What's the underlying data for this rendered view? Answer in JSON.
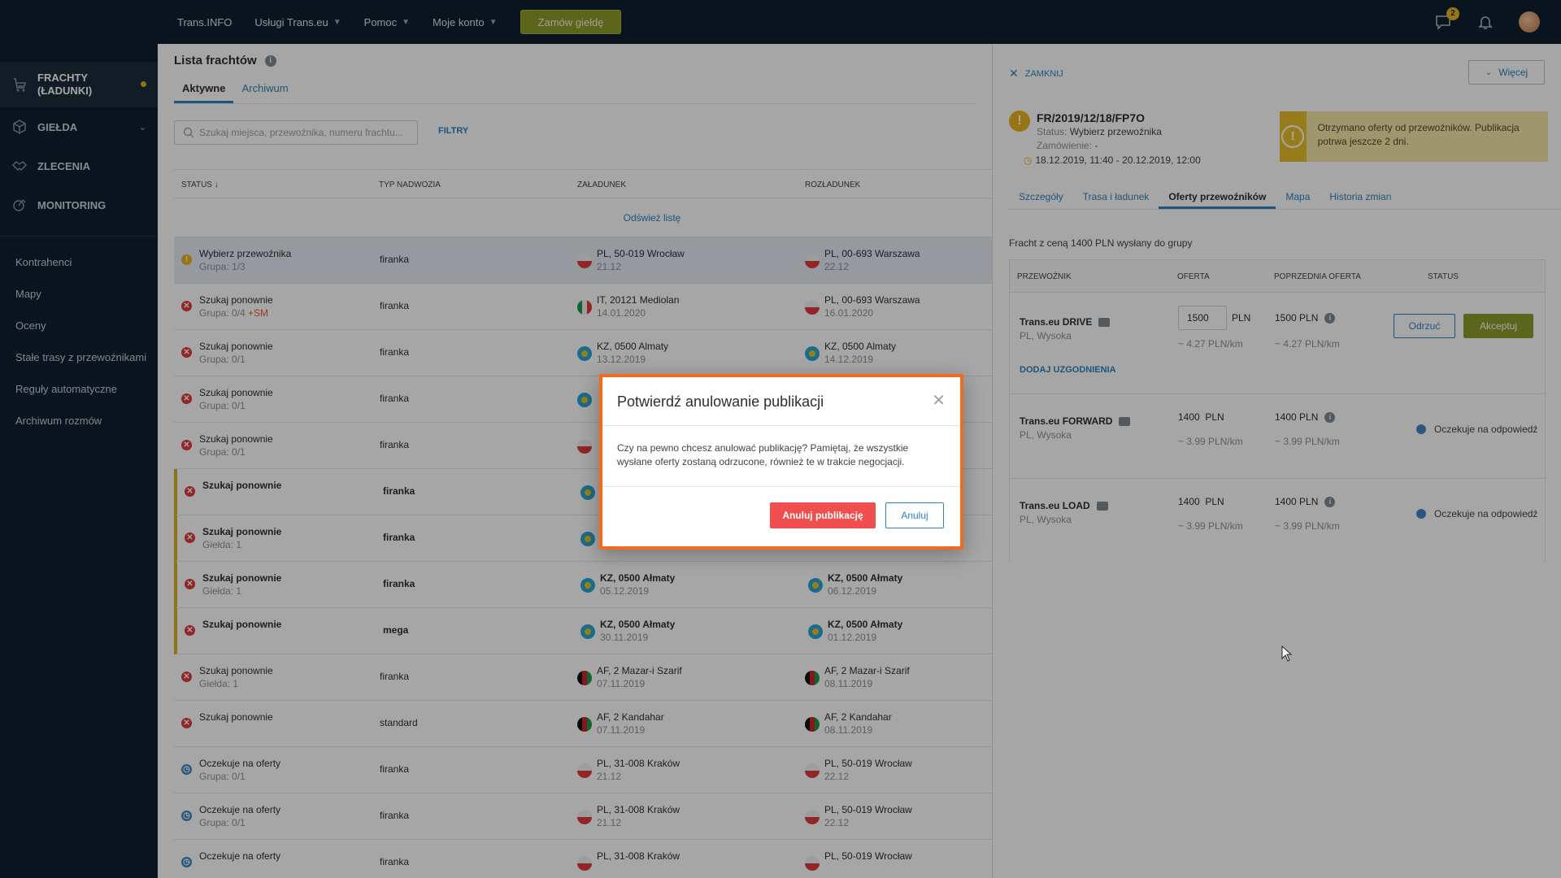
{
  "topnav": {
    "items": [
      "Trans.INFO",
      "Usługi Trans.eu",
      "Pomoc",
      "Moje konto"
    ],
    "order_button": "Zamów giełdę",
    "messages_badge": "2"
  },
  "sidebar": {
    "main": [
      {
        "label": "FRACHTY (ŁADUNKI)",
        "icon": "freight-icon"
      },
      {
        "label": "GIEŁDA",
        "icon": "box-icon"
      },
      {
        "label": "ZLECENIA",
        "icon": "handshake-icon"
      },
      {
        "label": "MONITORING",
        "icon": "monitoring-icon"
      }
    ],
    "links": [
      "Kontrahenci",
      "Mapy",
      "Oceny",
      "Stałe trasy z przewoźnikami",
      "Reguły automatyczne",
      "Archiwum rozmów"
    ]
  },
  "list": {
    "title": "Lista frachtów",
    "tabs": [
      "Aktywne",
      "Archiwum"
    ],
    "search_placeholder": "Szukaj miejsca, przewoźnika, numeru frachtu...",
    "filters": "FILTRY",
    "columns": [
      "STATUS ↓",
      "TYP NADWOZIA",
      "ZAŁADUNEK",
      "ROZŁADUNEK"
    ],
    "refresh": "Odśwież listę",
    "rows": [
      {
        "status": "Wybierz przewoźnika",
        "sub": "Grupa: 1/3",
        "hot": "",
        "icon": "warn",
        "body": "firanka",
        "load": "PL, 50-019 Wrocław",
        "load_date": "21.12",
        "load_flag": "pl",
        "unload": "PL, 00-693 Warszawa",
        "unload_date": "22.12",
        "unload_flag": "pl"
      },
      {
        "status": "Szukaj ponownie",
        "sub": "Grupa: 0/4",
        "hot": "+SM",
        "icon": "err",
        "body": "firanka",
        "load": "IT, 20121 Mediolan",
        "load_date": "14.01.2020",
        "load_flag": "it",
        "unload": "PL, 00-693 Warszawa",
        "unload_date": "16.01.2020",
        "unload_flag": "pl"
      },
      {
        "status": "Szukaj ponownie",
        "sub": "Grupa: 0/1",
        "hot": "",
        "icon": "err",
        "body": "firanka",
        "load": "KZ, 0500 Almaty",
        "load_date": "13.12.2019",
        "load_flag": "kz",
        "unload": "KZ, 0500 Almaty",
        "unload_date": "14.12.2019",
        "unload_flag": "kz"
      },
      {
        "status": "Szukaj ponownie",
        "sub": "Grupa: 0/1",
        "hot": "",
        "icon": "err",
        "body": "firanka",
        "load": "",
        "load_date": "",
        "load_flag": "kz",
        "unload": "",
        "unload_date": "",
        "unload_flag": ""
      },
      {
        "status": "Szukaj ponownie",
        "sub": "Grupa: 0/1",
        "hot": "",
        "icon": "err",
        "body": "firanka",
        "load": "",
        "load_date": "",
        "load_flag": "pl",
        "unload": "",
        "unload_date": "",
        "unload_flag": ""
      },
      {
        "status": "Szukaj ponownie",
        "sub": "",
        "hot": "",
        "icon": "err",
        "body": "firanka",
        "load": "",
        "load_date": "",
        "load_flag": "kz",
        "unload": "",
        "unload_date": "",
        "unload_flag": "",
        "bold": true
      },
      {
        "status": "Szukaj ponownie",
        "sub": "Giełda: 1",
        "hot": "",
        "icon": "err",
        "body": "firanka",
        "load": "",
        "load_date": "",
        "load_flag": "kz",
        "unload": "",
        "unload_date": "",
        "unload_flag": "",
        "bold": true
      },
      {
        "status": "Szukaj ponownie",
        "sub": "Giełda: 1",
        "hot": "",
        "icon": "err",
        "body": "firanka",
        "load": "KZ, 0500 Ałmaty",
        "load_date": "05.12.2019",
        "load_flag": "kz",
        "unload": "KZ, 0500 Ałmaty",
        "unload_date": "06.12.2019",
        "unload_flag": "kz",
        "bold": true
      },
      {
        "status": "Szukaj ponownie",
        "sub": "",
        "hot": "",
        "icon": "err",
        "body": "mega",
        "load": "KZ, 0500 Ałmaty",
        "load_date": "30.11.2019",
        "load_flag": "kz",
        "unload": "KZ, 0500 Ałmaty",
        "unload_date": "01.12.2019",
        "unload_flag": "kz",
        "bold": true
      },
      {
        "status": "Szukaj ponownie",
        "sub": "Giełda: 1",
        "hot": "",
        "icon": "err",
        "body": "firanka",
        "load": "AF, 2 Mazar-i Szarif",
        "load_date": "07.11.2019",
        "load_flag": "af",
        "unload": "AF, 2 Mazar-i Szarif",
        "unload_date": "08.11.2019",
        "unload_flag": "af"
      },
      {
        "status": "Szukaj ponownie",
        "sub": "",
        "hot": "",
        "icon": "err",
        "body": "standard",
        "load": "AF, 2 Kandahar",
        "load_date": "07.11.2019",
        "load_flag": "af",
        "unload": "AF, 2 Kandahar",
        "unload_date": "08.11.2019",
        "unload_flag": "af"
      },
      {
        "status": "Oczekuje na oferty",
        "sub": "Grupa: 0/1",
        "hot": "",
        "icon": "clock",
        "body": "firanka",
        "load": "PL, 31-008 Kraków",
        "load_date": "21.12",
        "load_flag": "pl",
        "unload": "PL, 50-019 Wrocław",
        "unload_date": "22.12",
        "unload_flag": "pl"
      },
      {
        "status": "Oczekuje na oferty",
        "sub": "Grupa: 0/1",
        "hot": "",
        "icon": "clock",
        "body": "firanka",
        "load": "PL, 31-008 Kraków",
        "load_date": "21.12",
        "load_flag": "pl",
        "unload": "PL, 50-019 Wrocław",
        "unload_date": "22.12",
        "unload_flag": "pl"
      },
      {
        "status": "Oczekuje na oferty",
        "sub": "",
        "hot": "",
        "icon": "clock",
        "body": "firanka",
        "load": "PL, 31-008 Kraków",
        "load_date": "",
        "load_flag": "pl",
        "unload": "PL, 50-019 Wrocław",
        "unload_date": "",
        "unload_flag": "pl"
      }
    ]
  },
  "detail": {
    "close": "ZAMKNIJ",
    "more": "Więcej",
    "freight_id": "FR/2019/12/18/FP7O",
    "status_label": "Status:",
    "status_value": "Wybierz przewoźnika",
    "order_label": "Zamówienie:",
    "order_value": "-",
    "dates": "18.12.2019, 11:40 - 20.12.2019, 12:00",
    "notice": "Otrzymano oferty od przewoźników. Publikacja potrwa jeszcze 2 dni.",
    "tabs": [
      "Szczegóły",
      "Trasa i ładunek",
      "Oferty przewoźników",
      "Mapa",
      "Historia zmian"
    ],
    "sent_info": "Fracht z ceną 1400 PLN wysłany do grupy",
    "columns": [
      "PRZEWOŹNIK",
      "OFERTA",
      "POPRZEDNIA OFERTA",
      "STATUS"
    ],
    "offers": [
      {
        "carrier": "Trans.eu DRIVE",
        "sub": "PL, Wysoka",
        "offer": "1500",
        "currency": "PLN",
        "rate": "~ 4.27 PLN/km",
        "prev": "1500 PLN",
        "prev_rate": "~ 4.27 PLN/km",
        "reject": "Odrzuć",
        "accept": "Akceptuj",
        "add": "DODAJ UZGODNIENIA"
      },
      {
        "carrier": "Trans.eu FORWARD",
        "sub": "PL, Wysoka",
        "offer": "1400  PLN",
        "rate": "~ 3.99 PLN/km",
        "prev": "1400 PLN",
        "prev_rate": "~ 3.99 PLN/km",
        "status": "Oczekuje na odpowiedź"
      },
      {
        "carrier": "Trans.eu LOAD",
        "sub": "PL, Wysoka",
        "offer": "1400  PLN",
        "rate": "~ 3.99 PLN/km",
        "prev": "1400 PLN",
        "prev_rate": "~ 3.99 PLN/km",
        "status": "Oczekuje na odpowiedź"
      }
    ]
  },
  "modal": {
    "title": "Potwierdź anulowanie publikacji",
    "body": "Czy na pewno chcesz anulować publikację? Pamiętaj, że wszystkie wysłane oferty zostaną odrzucone, również te w trakcie negocjacji.",
    "confirm": "Anuluj publikację",
    "cancel": "Anuluj"
  },
  "colors": {
    "accent": "#2f82c0",
    "order_green": "#8c9b2a",
    "danger": "#ef4f4f",
    "warning": "#e8b21f",
    "sidebar": "#0f1f2e"
  }
}
